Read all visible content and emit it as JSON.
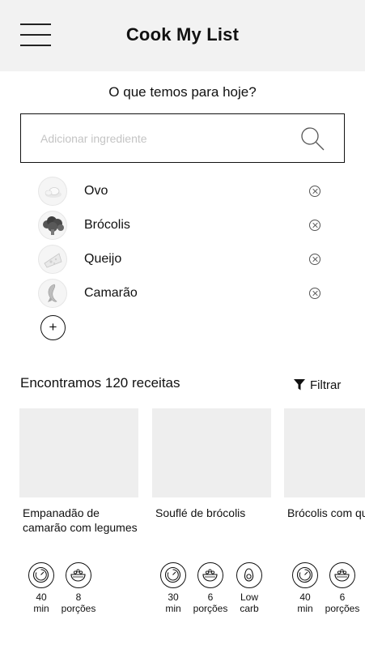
{
  "header": {
    "title": "Cook My List"
  },
  "prompt": "O que temos para hoje?",
  "search": {
    "placeholder": "Adicionar ingrediente",
    "value": ""
  },
  "ingredients": [
    {
      "name": "Ovo",
      "icon": "egg-icon"
    },
    {
      "name": "Brócolis",
      "icon": "broccoli-icon"
    },
    {
      "name": "Queijo",
      "icon": "cheese-icon"
    },
    {
      "name": "Camarão",
      "icon": "shrimp-icon"
    }
  ],
  "add_label": "+",
  "results": {
    "title": "Encontramos 120 receitas",
    "filter_label": "Filtrar"
  },
  "recipes": [
    {
      "title": "Empanadão de camarão com legumes",
      "meta": [
        {
          "icon": "timer-icon",
          "value": "40",
          "unit": "min"
        },
        {
          "icon": "bowl-icon",
          "value": "8",
          "unit": "porções"
        }
      ]
    },
    {
      "title": "Souflé de brócolis",
      "meta": [
        {
          "icon": "timer-icon",
          "value": "30",
          "unit": "min"
        },
        {
          "icon": "bowl-icon",
          "value": "6",
          "unit": "porções"
        },
        {
          "icon": "avocado-icon",
          "value": "Low",
          "unit": "carb"
        }
      ]
    },
    {
      "title": "Brócolis com queijo",
      "meta": [
        {
          "icon": "timer-icon",
          "value": "40",
          "unit": "min"
        },
        {
          "icon": "bowl-icon",
          "value": "6",
          "unit": "porções"
        }
      ]
    }
  ]
}
